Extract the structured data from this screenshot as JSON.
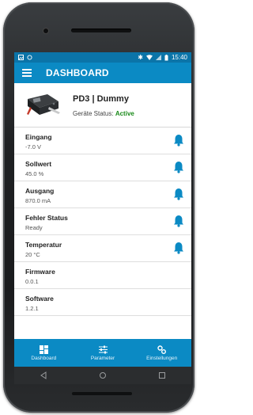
{
  "status_bar": {
    "time": "15:40"
  },
  "app_bar": {
    "title": "DASHBOARD"
  },
  "device": {
    "name": "PD3 | Dummy",
    "status_label": "Geräte Status:",
    "status_value": "Active"
  },
  "rows": [
    {
      "label": "Eingang",
      "value": "-7.0 V",
      "alarm_icon": "bell-icon"
    },
    {
      "label": "Sollwert",
      "value": "45.0 %",
      "alarm_icon": "bell-icon"
    },
    {
      "label": "Ausgang",
      "value": "870.0 mA",
      "alarm_icon": "bell-icon"
    },
    {
      "label": "Fehler Status",
      "value": "Ready",
      "alarm_icon": "bell-icon"
    },
    {
      "label": "Temperatur",
      "value": "20 °C",
      "alarm_icon": "bell-icon"
    },
    {
      "label": "Firmware",
      "value": "0.0.1"
    },
    {
      "label": "Software",
      "value": "1.2.1"
    }
  ],
  "bottom_nav": [
    {
      "label": "Dashboard",
      "icon": "dashboard-icon"
    },
    {
      "label": "Parameter",
      "icon": "sliders-icon"
    },
    {
      "label": "Einstellungen",
      "icon": "settings-icon"
    }
  ],
  "colors": {
    "primary": "#0b8ac4",
    "status_bar": "#0b74a8",
    "bell": "#0b8ac4",
    "active": "#1a8a1a"
  }
}
